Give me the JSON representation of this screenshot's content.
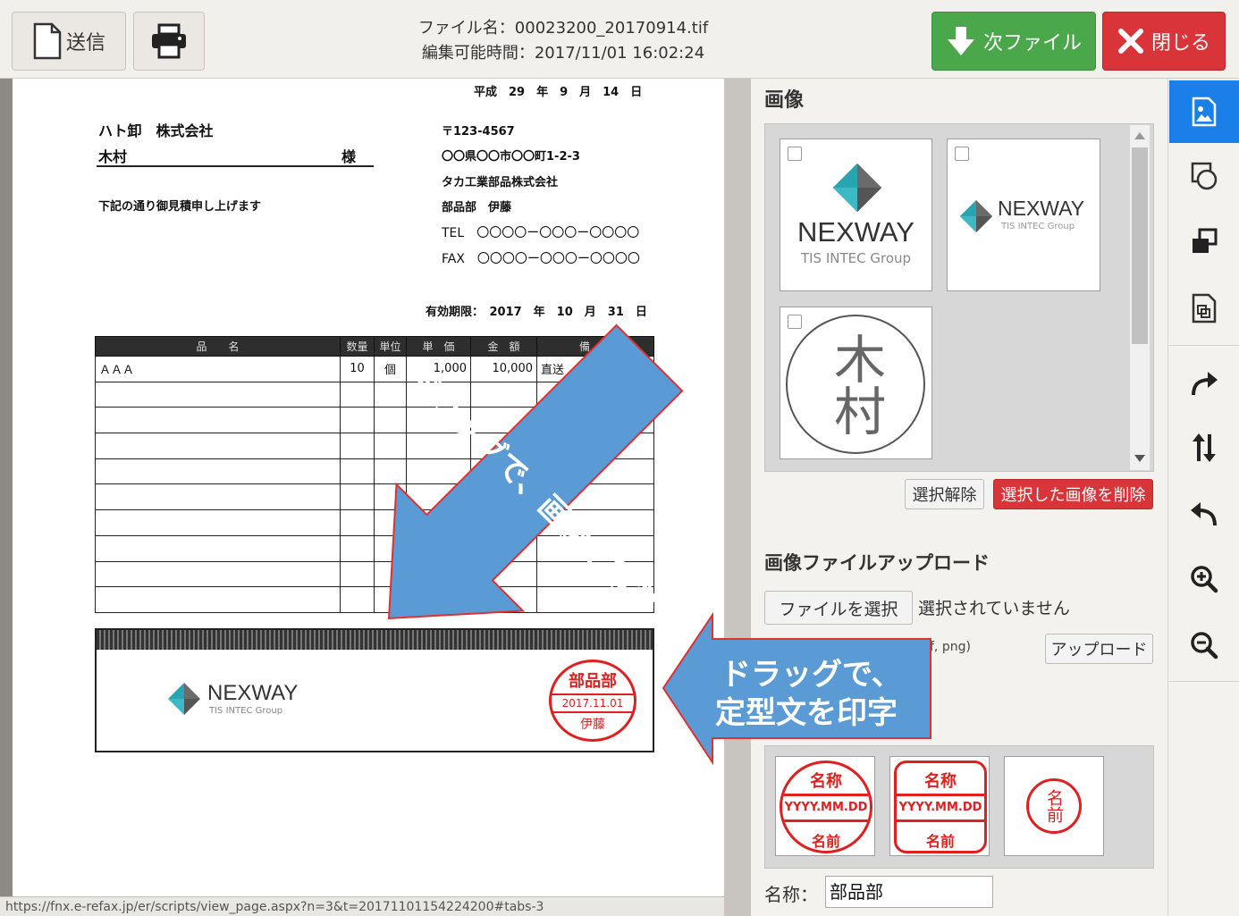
{
  "toolbar": {
    "send_label": "送信",
    "file_name": "ファイル名：00023200_20170914.tif",
    "edit_time": "編集可能時間：2017/11/01 16:02:24",
    "next_label": "次ファイル",
    "close_label": "閉じる"
  },
  "document": {
    "date_line": "平成　29　年　9　月　14　日",
    "company": "ハト卸　株式会社",
    "person": "木村",
    "honorific": "様",
    "postal": "〒123-4567",
    "address": "〇〇県〇〇市〇〇町1-2-3",
    "sender_company": "タカ工業部品株式会社",
    "sender_dept": "部品部　伊藤",
    "tel": "TEL　〇〇〇〇ー〇〇〇ー〇〇〇〇",
    "fax": "FAX　〇〇〇〇ー〇〇〇ー〇〇〇〇",
    "intro": "下記の通り御見積申し上げます",
    "validity": "有効期限：　2017　年　10　月　31　日",
    "table_headers": [
      "品　　名",
      "数量",
      "単位",
      "単　価",
      "金　額",
      "備　考"
    ],
    "table_row": [
      "ＡＡＡ",
      "10",
      "個",
      "1,000",
      "10,000",
      "直送　9月"
    ],
    "logo_text": "NEXWAY",
    "logo_sub": "TIS INTEC Group",
    "stamp_top": "部品部",
    "stamp_date": "2017.11.01",
    "stamp_name": "伊藤"
  },
  "status_url": "https://fnx.e-refax.jp/er/scripts/view_page.aspx?n=3&t=20171101154224200#tabs-3",
  "callouts": {
    "image_drag": "ドラッグで、画像を印字",
    "text_drag_1": "ドラッグで、",
    "text_drag_2": "定型文を印字"
  },
  "panel": {
    "image_title": "画像",
    "images": [
      {
        "brand": "NEXWAY",
        "sub": "TIS INTEC Group"
      },
      {
        "brand": "NEXWAY",
        "sub": "TIS INTEC Group"
      },
      {
        "chars": "木村"
      }
    ],
    "deselect_label": "選択解除",
    "delete_label": "選択した画像を削除",
    "upload_title": "画像ファイルアップロード",
    "choose_file_label": "ファイルを選択",
    "no_file_text": "選択されていません",
    "file_types": "f, png)",
    "upload_label": "アップロード",
    "stamps": [
      {
        "top": "名称",
        "mid": "YYYY.MM.DD",
        "bot": "名前"
      },
      {
        "top": "名称",
        "mid": "YYYY.MM.DD",
        "bot": "名前"
      },
      {
        "text": "名前"
      }
    ],
    "name_label": "名称：",
    "name_value": "部品部"
  },
  "colors": {
    "accent_blue": "#1a7fe8",
    "next_green": "#4aa84a",
    "close_red": "#d8343a",
    "callout_blue": "#5b9bd5",
    "stamp_red": "#e02020"
  }
}
